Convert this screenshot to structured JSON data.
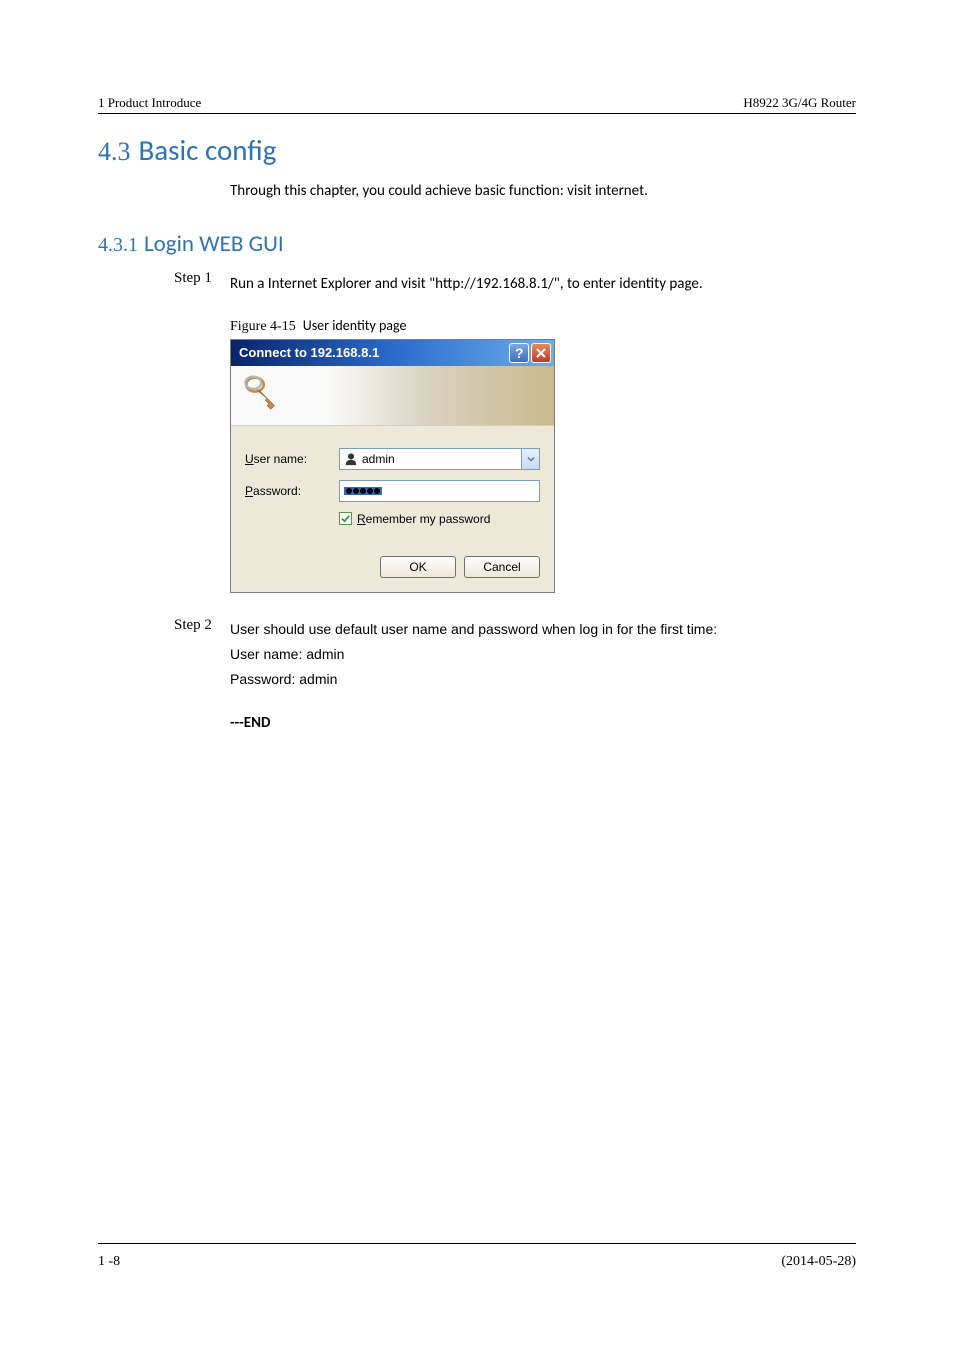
{
  "header": {
    "left": "1 Product Introduce",
    "right": "H8922 3G/4G Router"
  },
  "section": {
    "number": "4.3",
    "title": "Basic config",
    "intro": "Through this chapter, you could achieve basic function: visit internet."
  },
  "subsection": {
    "number": "4.3.1",
    "title": "Login WEB GUI"
  },
  "step1": {
    "label": "Step 1",
    "text": "Run a Internet Explorer and visit \"http://192.168.8.1/\", to enter identity page."
  },
  "figure": {
    "caption_prefix": "Figure 4-15",
    "caption_text": "User identity page"
  },
  "dialog": {
    "title": "Connect to 192.168.8.1",
    "username_label_u": "U",
    "username_label_rest": "ser name:",
    "username_value": "admin",
    "password_label_p": "P",
    "password_label_rest": "assword:",
    "remember_r": "R",
    "remember_rest": "emember my password",
    "ok": "OK",
    "cancel": "Cancel"
  },
  "step2": {
    "label": "Step 2",
    "line1": "User should use default user name and password when log in for the first time:",
    "line2": "User name: admin",
    "line3": "Password: admin"
  },
  "end": "---END",
  "footer": {
    "left": "1 -8",
    "right": "(2014-05-28)"
  }
}
